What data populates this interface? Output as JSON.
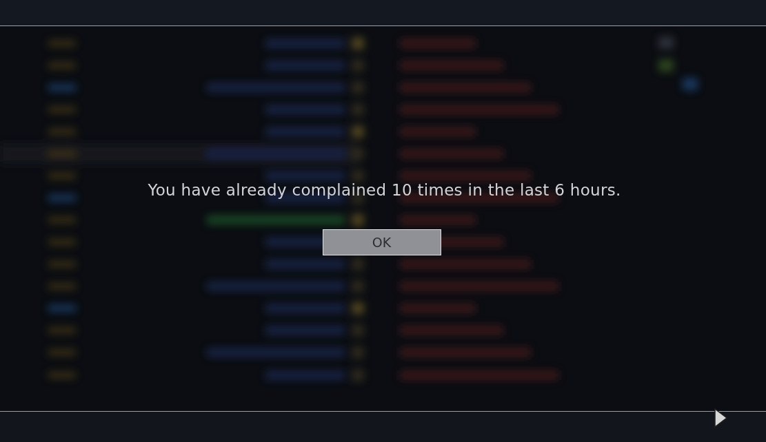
{
  "dialog": {
    "message": "You have already complained 10 times in the last 6 hours.",
    "buttons": [
      {
        "label": "OK"
      }
    ]
  }
}
